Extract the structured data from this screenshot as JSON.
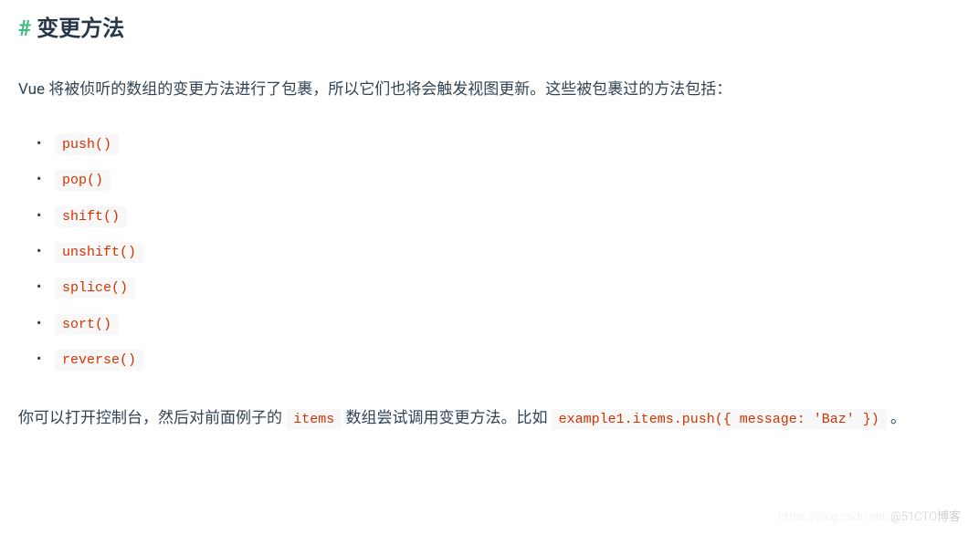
{
  "heading": {
    "hash": "#",
    "title": "变更方法"
  },
  "intro": "Vue 将被侦听的数组的变更方法进行了包裹，所以它们也将会触发视图更新。这些被包裹过的方法包括：",
  "methods": [
    "push()",
    "pop()",
    "shift()",
    "unshift()",
    "splice()",
    "sort()",
    "reverse()"
  ],
  "closing": {
    "part1": "你可以打开控制台，然后对前面例子的 ",
    "code1": "items",
    "part2": " 数组尝试调用变更方法。比如 ",
    "code2": "example1.items.push({ message: 'Baz' })",
    "part3": " 。"
  },
  "watermark": {
    "faint": "https://blog.csdn.net/",
    "text": "@51CTO博客"
  }
}
